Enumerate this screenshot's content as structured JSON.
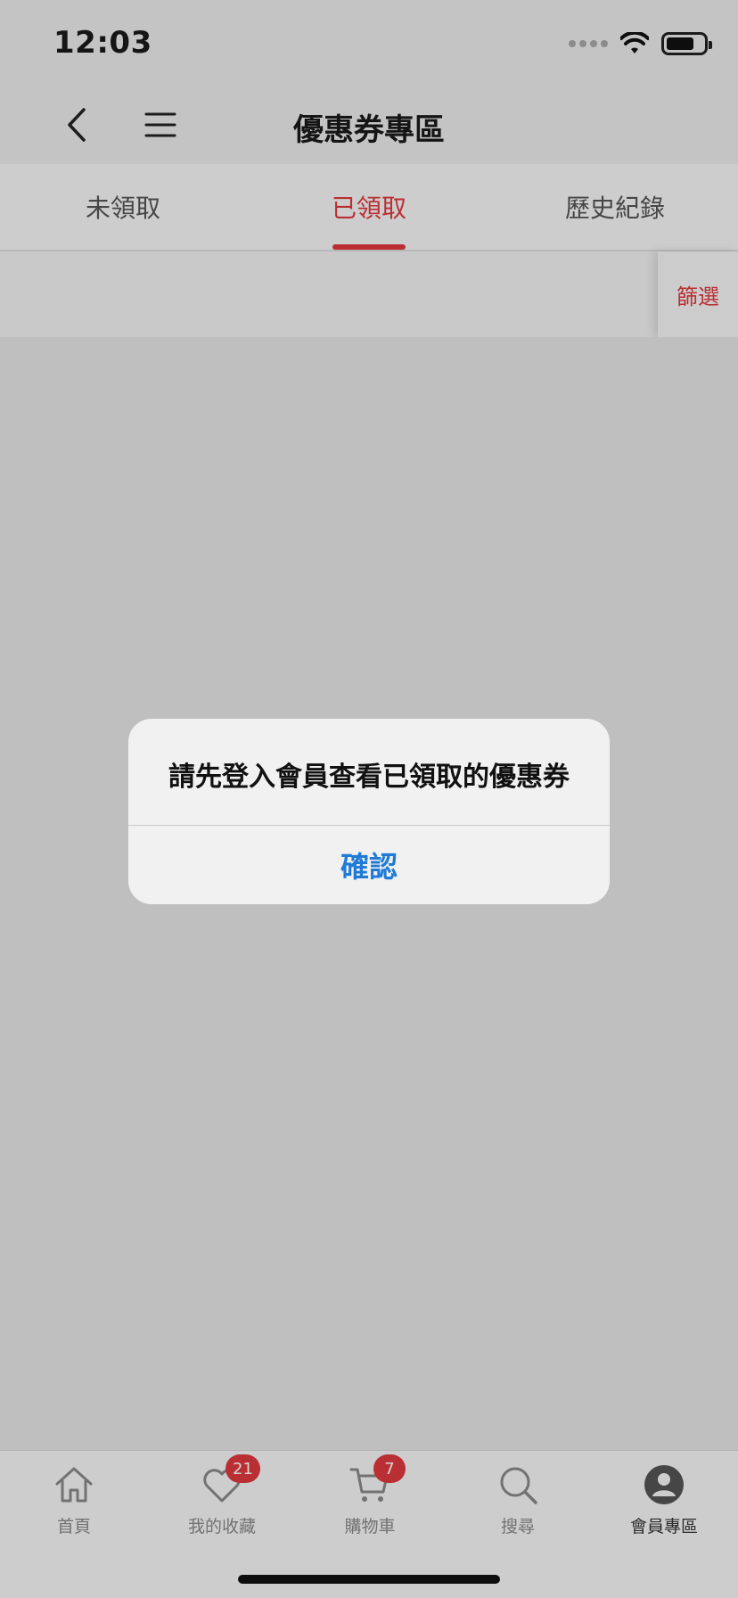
{
  "status_bar": {
    "time": "12:03"
  },
  "nav": {
    "title": "優惠券專區"
  },
  "tabs": [
    {
      "label": "未領取"
    },
    {
      "label": "已領取"
    },
    {
      "label": "歷史紀錄"
    }
  ],
  "filter": {
    "label": "篩選"
  },
  "tabbar": {
    "items": [
      {
        "label": "首頁"
      },
      {
        "label": "我的收藏",
        "badge": "21"
      },
      {
        "label": "購物車",
        "badge": "7"
      },
      {
        "label": "搜尋"
      },
      {
        "label": "會員專區"
      }
    ]
  },
  "alert": {
    "message": "請先登入會員查看已領取的優惠券",
    "confirm_label": "確認"
  },
  "colors": {
    "accent": "#e0393e",
    "link": "#1f7bd7"
  }
}
